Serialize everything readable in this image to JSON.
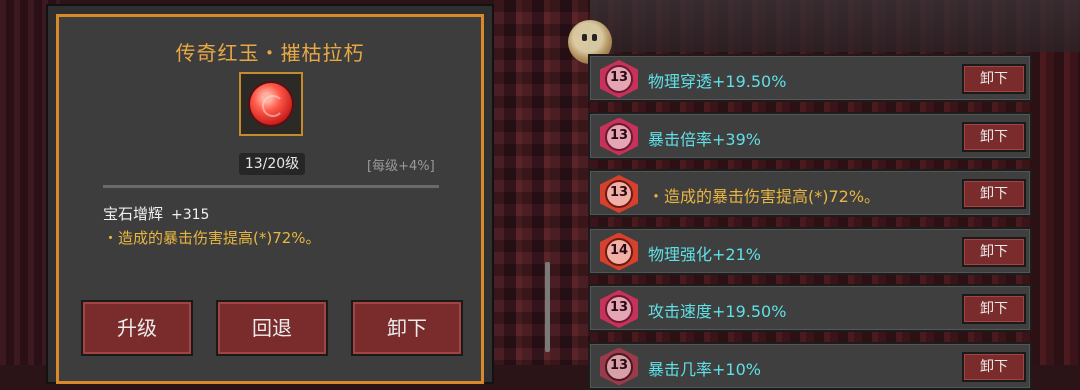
{
  "gem_detail": {
    "title": "传奇红玉・摧枯拉朽",
    "gem_icon": "red-gem-icon",
    "level": "13/20级",
    "per_level": "[每级+4%]",
    "stat_name": "宝石增辉",
    "stat_value": "+315",
    "effect": "・造成的暴击伤害提高(*)72%。",
    "buttons": {
      "upgrade": "升级",
      "rollback": "回退",
      "unequip": "卸下"
    }
  },
  "gem_list": [
    {
      "level": "13",
      "text": "物理穿透+19.50%",
      "color": "cyan",
      "badge": "pink",
      "action": "卸下"
    },
    {
      "level": "13",
      "text": "暴击倍率+39%",
      "color": "cyan",
      "badge": "pink",
      "action": "卸下"
    },
    {
      "level": "13",
      "text": "・造成的暴击伤害提高(*)72%。",
      "color": "gold",
      "badge": "red",
      "action": "卸下"
    },
    {
      "level": "14",
      "text": "物理强化+21%",
      "color": "cyan",
      "badge": "red",
      "action": "卸下"
    },
    {
      "level": "13",
      "text": "攻击速度+19.50%",
      "color": "cyan",
      "badge": "pink",
      "action": "卸下"
    },
    {
      "level": "13",
      "text": "暴击几率+10%",
      "color": "cyan",
      "badge": "dark",
      "action": "卸下"
    }
  ],
  "colors": {
    "accent": "#d9892a",
    "cyan_text": "#5fe0e6",
    "gold_text": "#e8b640",
    "button": "#7a2b2b"
  }
}
